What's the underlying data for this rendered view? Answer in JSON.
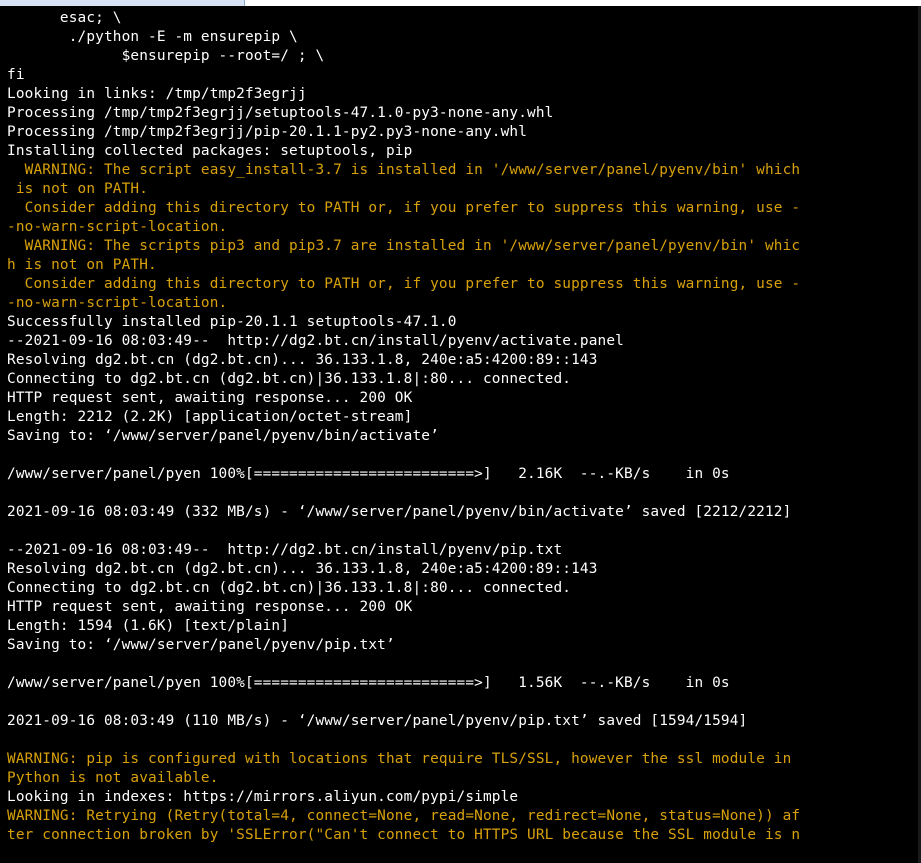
{
  "colors": {
    "background": "#000000",
    "text": "#ffffff",
    "warning": "#d8a10a"
  },
  "terminal": {
    "lines": [
      {
        "text": "      esac; \\",
        "kind": "normal"
      },
      {
        "text": "       ./python -E -m ensurepip \\",
        "kind": "normal"
      },
      {
        "text": "             $ensurepip --root=/ ; \\",
        "kind": "normal"
      },
      {
        "text": "fi",
        "kind": "normal"
      },
      {
        "text": "Looking in links: /tmp/tmp2f3egrjj",
        "kind": "normal"
      },
      {
        "text": "Processing /tmp/tmp2f3egrjj/setuptools-47.1.0-py3-none-any.whl",
        "kind": "normal"
      },
      {
        "text": "Processing /tmp/tmp2f3egrjj/pip-20.1.1-py2.py3-none-any.whl",
        "kind": "normal"
      },
      {
        "text": "Installing collected packages: setuptools, pip",
        "kind": "normal"
      },
      {
        "text": "  WARNING: The script easy_install-3.7 is installed in '/www/server/panel/pyenv/bin' which",
        "kind": "warning"
      },
      {
        "text": " is not on PATH.",
        "kind": "warning"
      },
      {
        "text": "  Consider adding this directory to PATH or, if you prefer to suppress this warning, use -",
        "kind": "warning"
      },
      {
        "text": "-no-warn-script-location.",
        "kind": "warning"
      },
      {
        "text": "  WARNING: The scripts pip3 and pip3.7 are installed in '/www/server/panel/pyenv/bin' whic",
        "kind": "warning"
      },
      {
        "text": "h is not on PATH.",
        "kind": "warning"
      },
      {
        "text": "  Consider adding this directory to PATH or, if you prefer to suppress this warning, use -",
        "kind": "warning"
      },
      {
        "text": "-no-warn-script-location.",
        "kind": "warning"
      },
      {
        "text": "Successfully installed pip-20.1.1 setuptools-47.1.0",
        "kind": "normal"
      },
      {
        "text": "--2021-09-16 08:03:49--  http://dg2.bt.cn/install/pyenv/activate.panel",
        "kind": "normal"
      },
      {
        "text": "Resolving dg2.bt.cn (dg2.bt.cn)... 36.133.1.8, 240e:a5:4200:89::143",
        "kind": "normal"
      },
      {
        "text": "Connecting to dg2.bt.cn (dg2.bt.cn)|36.133.1.8|:80... connected.",
        "kind": "normal"
      },
      {
        "text": "HTTP request sent, awaiting response... 200 OK",
        "kind": "normal"
      },
      {
        "text": "Length: 2212 (2.2K) [application/octet-stream]",
        "kind": "normal"
      },
      {
        "text": "Saving to: ‘/www/server/panel/pyenv/bin/activate’",
        "kind": "normal"
      },
      {
        "text": "",
        "kind": "normal"
      },
      {
        "text": "/www/server/panel/pyen 100%[=========================>]   2.16K  --.-KB/s    in 0s",
        "kind": "normal"
      },
      {
        "text": "",
        "kind": "normal"
      },
      {
        "text": "2021-09-16 08:03:49 (332 MB/s) - ‘/www/server/panel/pyenv/bin/activate’ saved [2212/2212]",
        "kind": "normal"
      },
      {
        "text": "",
        "kind": "normal"
      },
      {
        "text": "--2021-09-16 08:03:49--  http://dg2.bt.cn/install/pyenv/pip.txt",
        "kind": "normal"
      },
      {
        "text": "Resolving dg2.bt.cn (dg2.bt.cn)... 36.133.1.8, 240e:a5:4200:89::143",
        "kind": "normal"
      },
      {
        "text": "Connecting to dg2.bt.cn (dg2.bt.cn)|36.133.1.8|:80... connected.",
        "kind": "normal"
      },
      {
        "text": "HTTP request sent, awaiting response... 200 OK",
        "kind": "normal"
      },
      {
        "text": "Length: 1594 (1.6K) [text/plain]",
        "kind": "normal"
      },
      {
        "text": "Saving to: ‘/www/server/panel/pyenv/pip.txt’",
        "kind": "normal"
      },
      {
        "text": "",
        "kind": "normal"
      },
      {
        "text": "/www/server/panel/pyen 100%[=========================>]   1.56K  --.-KB/s    in 0s",
        "kind": "normal"
      },
      {
        "text": "",
        "kind": "normal"
      },
      {
        "text": "2021-09-16 08:03:49 (110 MB/s) - ‘/www/server/panel/pyenv/pip.txt’ saved [1594/1594]",
        "kind": "normal"
      },
      {
        "text": "",
        "kind": "normal"
      },
      {
        "text": "WARNING: pip is configured with locations that require TLS/SSL, however the ssl module in",
        "kind": "warning"
      },
      {
        "text": "Python is not available.",
        "kind": "warning"
      },
      {
        "text": "Looking in indexes: https://mirrors.aliyun.com/pypi/simple",
        "kind": "normal"
      },
      {
        "text": "WARNING: Retrying (Retry(total=4, connect=None, read=None, redirect=None, status=None)) af",
        "kind": "warning"
      },
      {
        "text": "ter connection broken by 'SSLError(\"Can't connect to HTTPS URL because the SSL module is n",
        "kind": "warning"
      }
    ]
  }
}
